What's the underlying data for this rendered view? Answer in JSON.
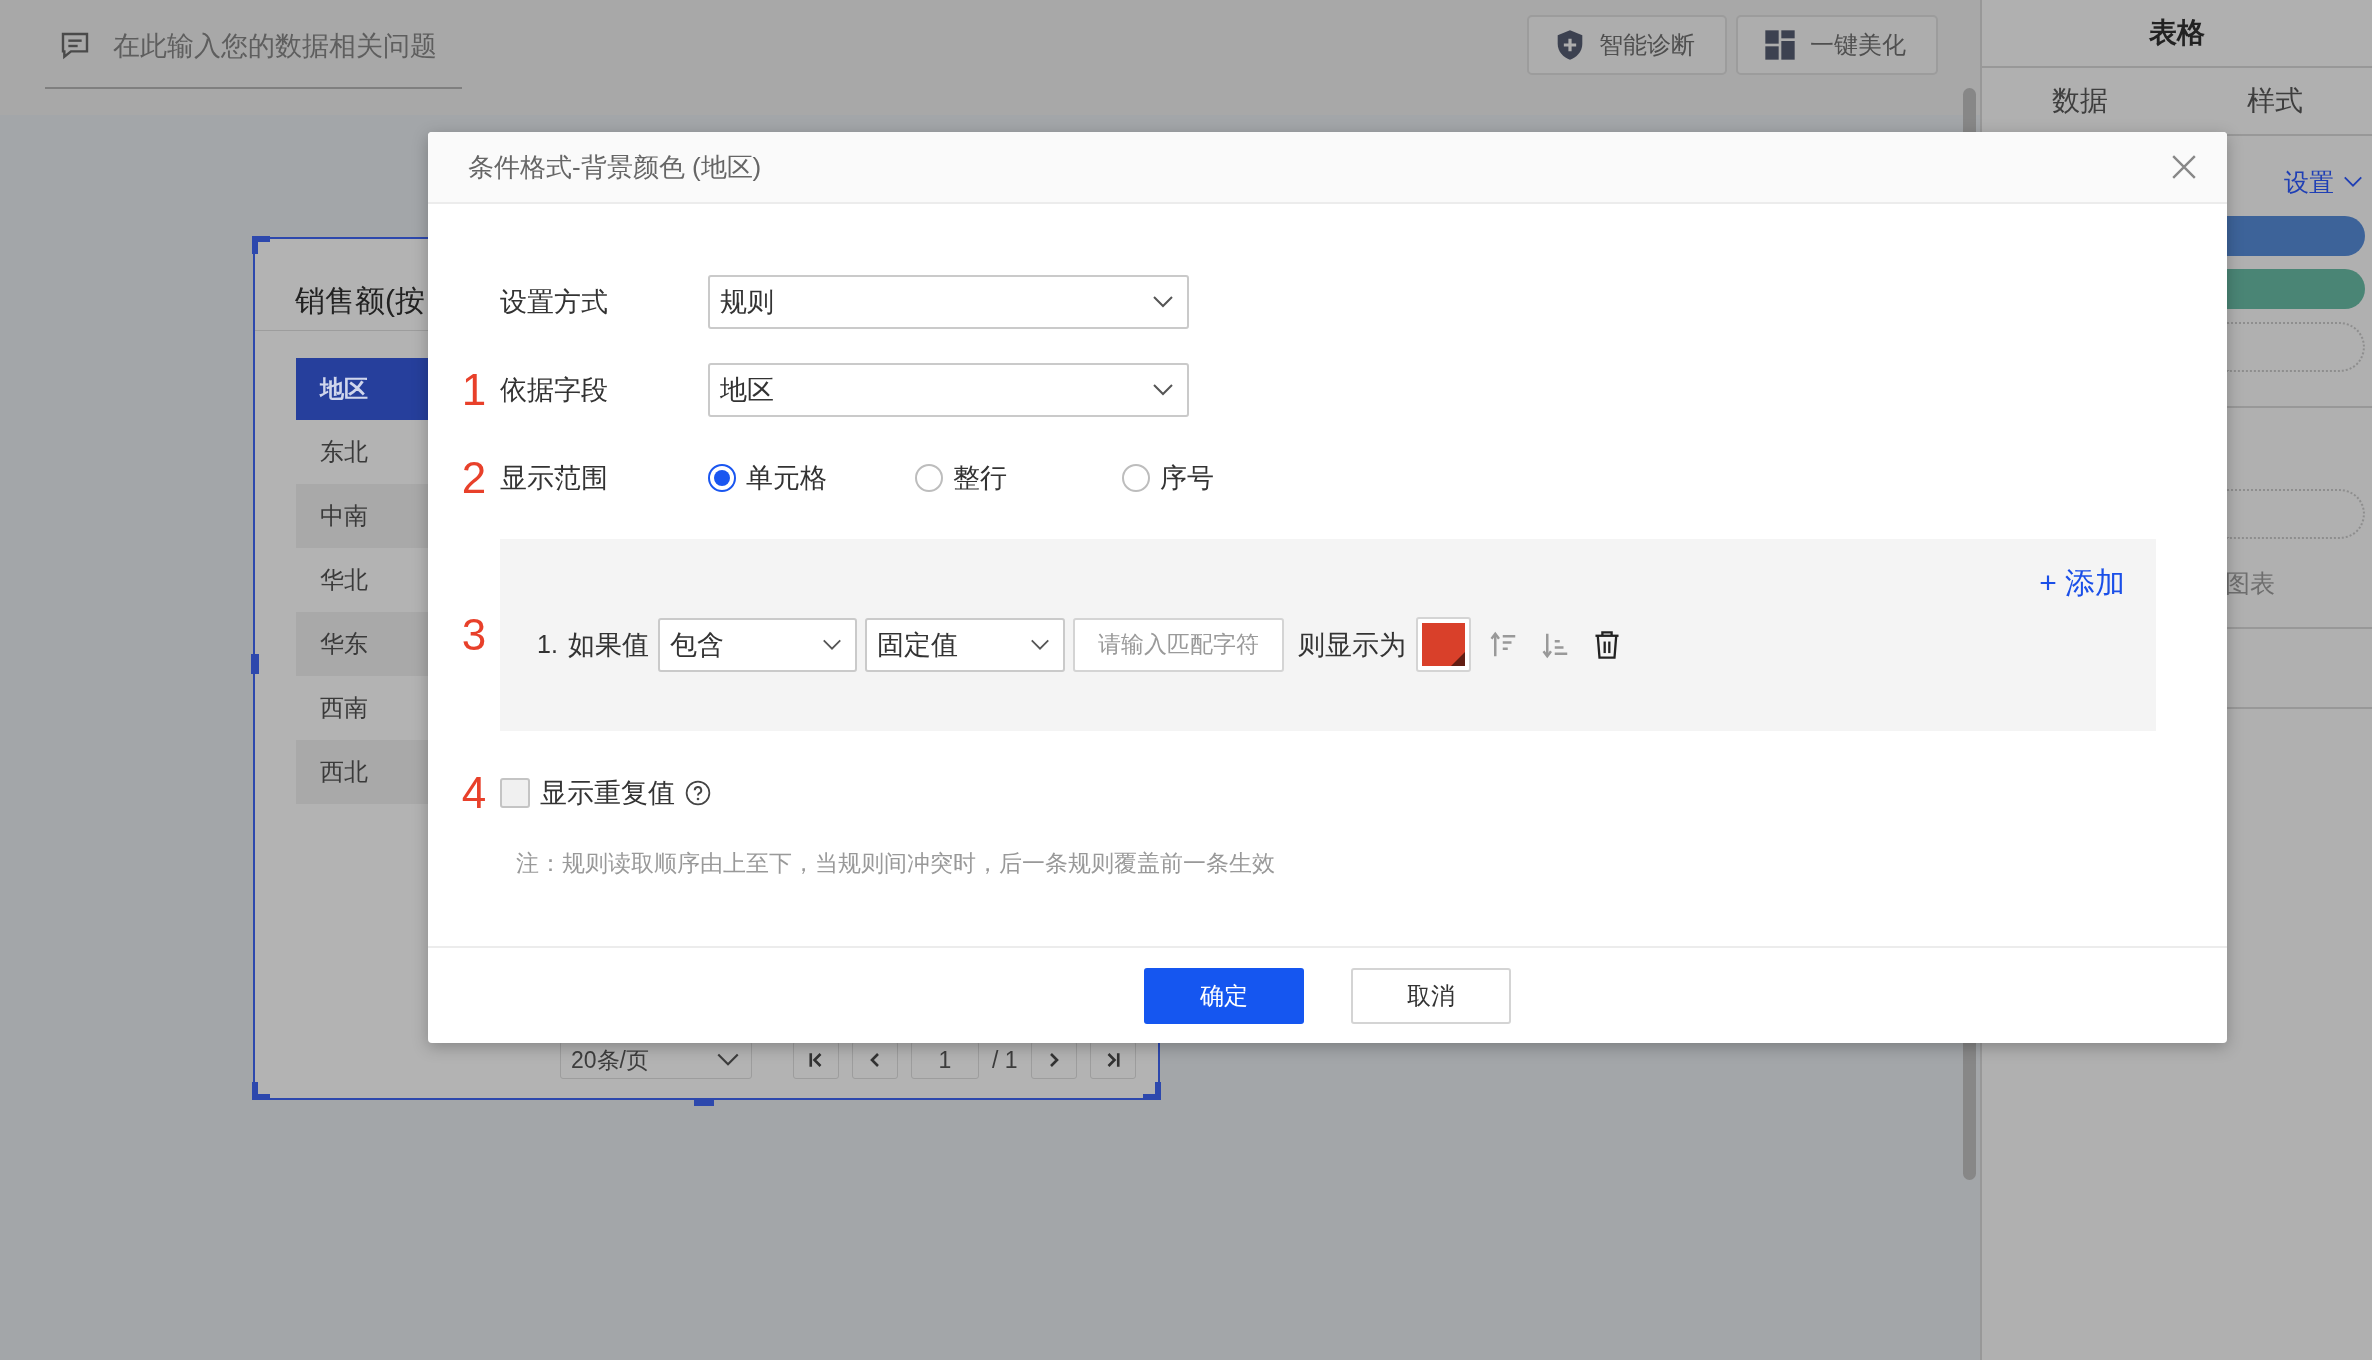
{
  "search": {
    "placeholder": "在此输入您的数据相关问题"
  },
  "toolbar_buttons": [
    {
      "label": "智能诊断",
      "kind": "diagnose"
    },
    {
      "label": "一键美化",
      "kind": "beautify"
    }
  ],
  "report": {
    "title": "销售额(按",
    "table": {
      "header": "地区",
      "rows": [
        "东北",
        "中南",
        "华北",
        "华东",
        "西南",
        "西北"
      ]
    },
    "pagination": {
      "page_size": "20条/页",
      "page": "1",
      "total": "/ 1"
    }
  },
  "panel": {
    "title": "表格",
    "tabs": [
      "数据",
      "样式"
    ],
    "settings_link": "设置",
    "chart_label": "图表"
  },
  "dialog": {
    "title": "条件格式-背景颜色 (地区)",
    "fields": [
      {
        "label": "设置方式",
        "value": "规则"
      },
      {
        "step": "1",
        "label": "依据字段",
        "value": "地区"
      }
    ],
    "scope": {
      "step": "2",
      "label": "显示范围",
      "options": [
        {
          "label": "单元格",
          "selected": true
        },
        {
          "label": "整行",
          "selected": false
        },
        {
          "label": "序号",
          "selected": false
        }
      ]
    },
    "rules": {
      "step": "3",
      "add": "+ 添加",
      "items": [
        {
          "index": "1.",
          "if_label": "如果值",
          "operator": "包含",
          "value_type": "固定值",
          "placeholder": "请输入匹配字符",
          "then_label": "则显示为",
          "color": "#d9402a"
        }
      ]
    },
    "repeat": {
      "step": "4",
      "label": "显示重复值",
      "checked": false
    },
    "note": "注：规则读取顺序由上至下，当规则间冲突时，后一条规则覆盖前一条生效",
    "buttons": [
      {
        "label": "确定",
        "kind": "primary"
      },
      {
        "label": "取消",
        "kind": "default"
      }
    ]
  }
}
